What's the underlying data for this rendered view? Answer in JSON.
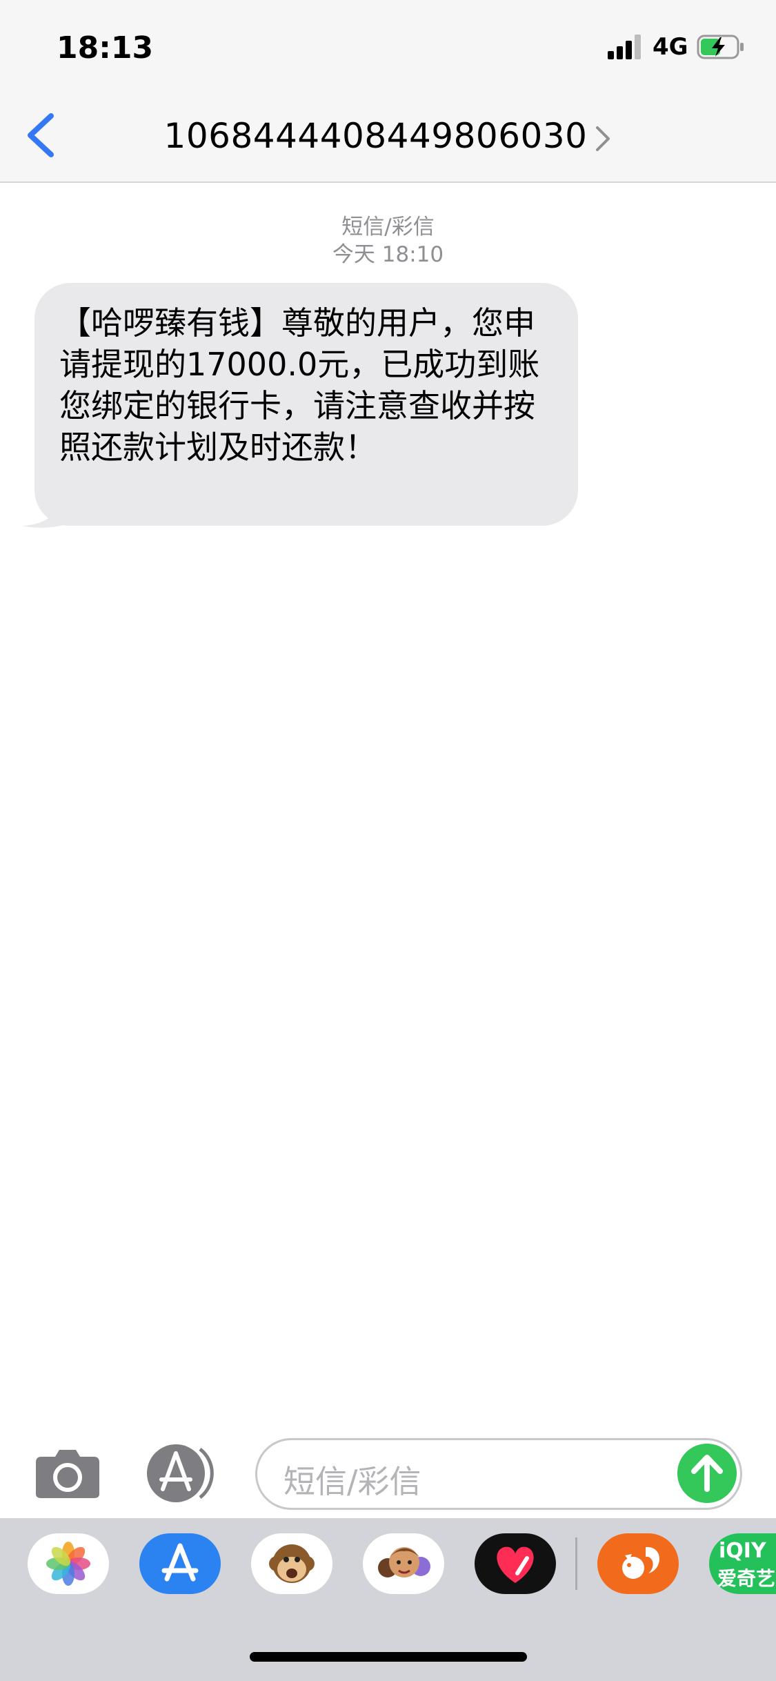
{
  "status_bar": {
    "time": "18:13",
    "network": "4G",
    "icons": [
      "signal-icon",
      "battery-charging-icon"
    ]
  },
  "nav": {
    "contact": "1068444408449806030",
    "icons": [
      "chevron-left-icon",
      "chevron-right-icon"
    ]
  },
  "conversation": {
    "kind_label": "短信/彩信",
    "timestamp": "今天 18:10",
    "messages": [
      {
        "direction": "incoming",
        "text": "【哈啰臻有钱】尊敬的用户，您申请提现的17000.0元，已成功到账您绑定的银行卡，请注意查收并按照还款计划及时还款！"
      }
    ]
  },
  "composer": {
    "placeholder": "短信/彩信",
    "icons": [
      "camera-icon",
      "app-store-icon",
      "send-arrow-icon"
    ],
    "send_color": "#34c759"
  },
  "app_drawer": {
    "apps": [
      "photos-icon",
      "app-store-icon",
      "monkey-animoji-icon",
      "memoji-icon",
      "digital-touch-heart-icon",
      "squirrel-app-icon",
      "iqiyi-icon"
    ],
    "iqiyi_label_top": "iQIY",
    "iqiyi_label_bottom": "爱奇艺"
  },
  "colors": {
    "accent": "#3478f6",
    "bubble": "#e9e9eb",
    "meta_text": "#8e8e93"
  }
}
